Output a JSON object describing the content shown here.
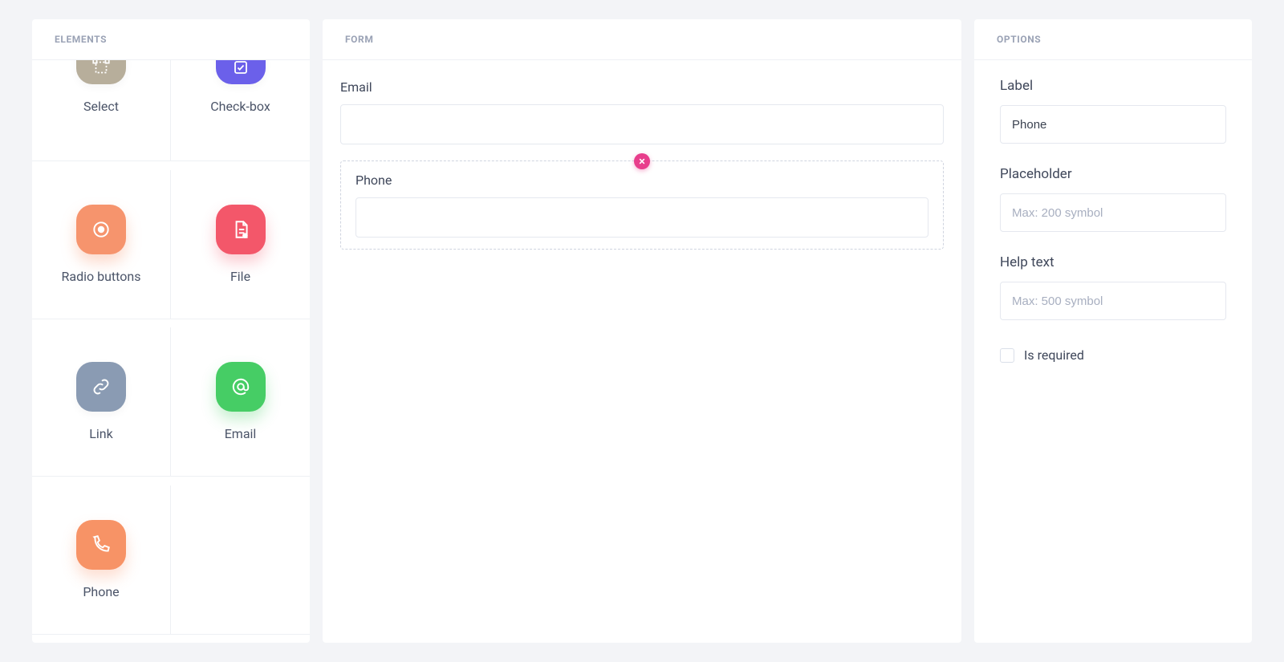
{
  "elements": {
    "header": "ELEMENTS",
    "items": [
      {
        "label": "Select",
        "icon": "select-icon",
        "color": "bg-taupe"
      },
      {
        "label": "Check-box",
        "icon": "checkbox-icon",
        "color": "bg-indigo"
      },
      {
        "label": "Radio buttons",
        "icon": "radio-icon",
        "color": "bg-peach"
      },
      {
        "label": "File",
        "icon": "file-icon",
        "color": "bg-rose"
      },
      {
        "label": "Link",
        "icon": "link-icon",
        "color": "bg-slate"
      },
      {
        "label": "Email",
        "icon": "at-icon",
        "color": "bg-green"
      },
      {
        "label": "Phone",
        "icon": "phone-icon",
        "color": "bg-orange"
      }
    ]
  },
  "form": {
    "header": "FORM",
    "fields": [
      {
        "label": "Email",
        "value": "",
        "placeholder": "",
        "selected": false
      },
      {
        "label": "Phone",
        "value": "",
        "placeholder": "",
        "selected": true
      }
    ]
  },
  "options": {
    "header": "OPTIONS",
    "label_heading": "Label",
    "label_value": "Phone",
    "placeholder_heading": "Placeholder",
    "placeholder_placeholder": "Max: 200 symbol",
    "placeholder_value": "",
    "help_heading": "Help text",
    "help_placeholder": "Max: 500 symbol",
    "help_value": "",
    "required_label": "Is required",
    "required_checked": false
  },
  "colors": {
    "accent_pink": "#e83e8c",
    "border": "#e5e8ef",
    "muted": "#9aa2b5"
  }
}
